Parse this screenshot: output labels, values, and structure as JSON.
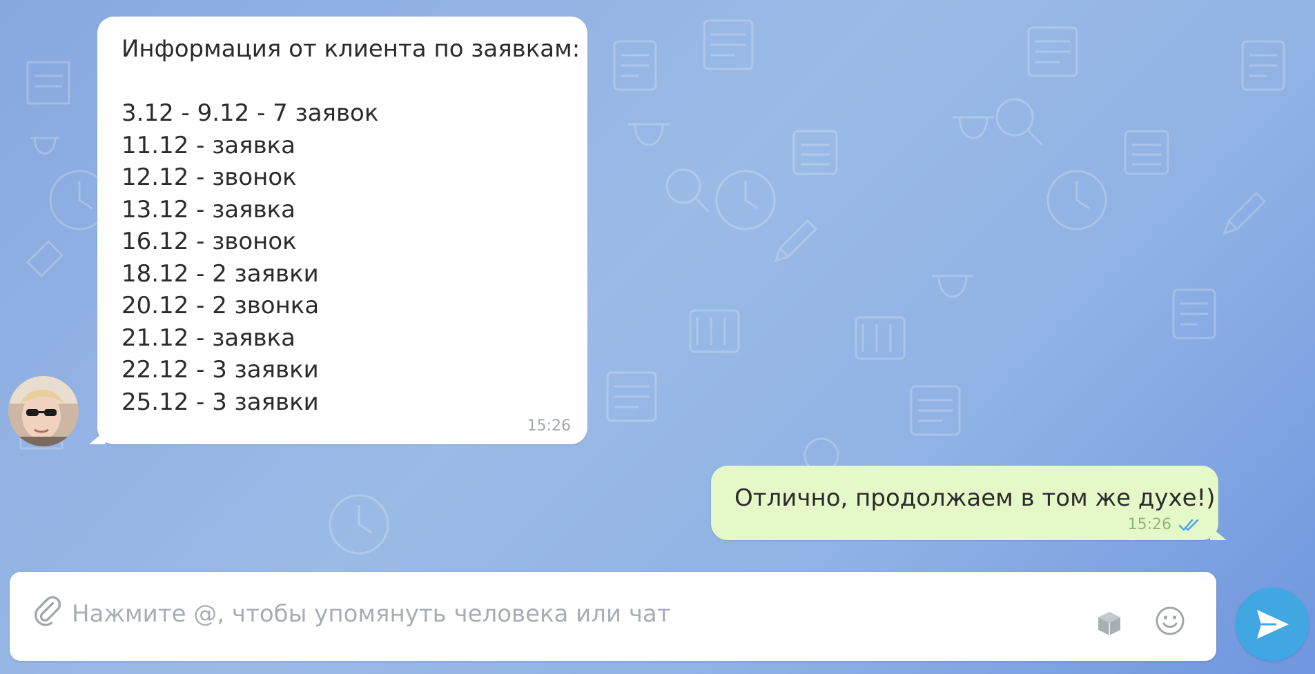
{
  "chat": {
    "incoming": {
      "lines": [
        "Информация от клиента по заявкам:",
        "",
        "3.12 - 9.12 - 7 заявок",
        "11.12 - заявка",
        "12.12 - звонок",
        "13.12 - заявка",
        "16.12 - звонок",
        "18.12 - 2 заявки",
        "20.12 - 2 звонка",
        "21.12 - заявка",
        "22.12 - 3 заявки",
        "25.12 - 3 заявки"
      ],
      "time": "15:26",
      "avatar_icon": "user-avatar"
    },
    "outgoing": {
      "text": "Отлично, продолжаем в том же духе!)",
      "time": "15:26",
      "status_icon": "double-check-icon"
    }
  },
  "composer": {
    "placeholder": "Нажмите @, чтобы упомянуть человека или чат",
    "value": "",
    "attach_icon": "paperclip-icon",
    "sticker_icon": "sticker-icon",
    "emoji_icon": "smiley-icon",
    "send_icon": "send-icon"
  },
  "colors": {
    "incoming_bubble": "#ffffff",
    "outgoing_bubble": "#e4f8c8",
    "send_button": "#40a7e3",
    "read_check": "#4fa3e0"
  }
}
